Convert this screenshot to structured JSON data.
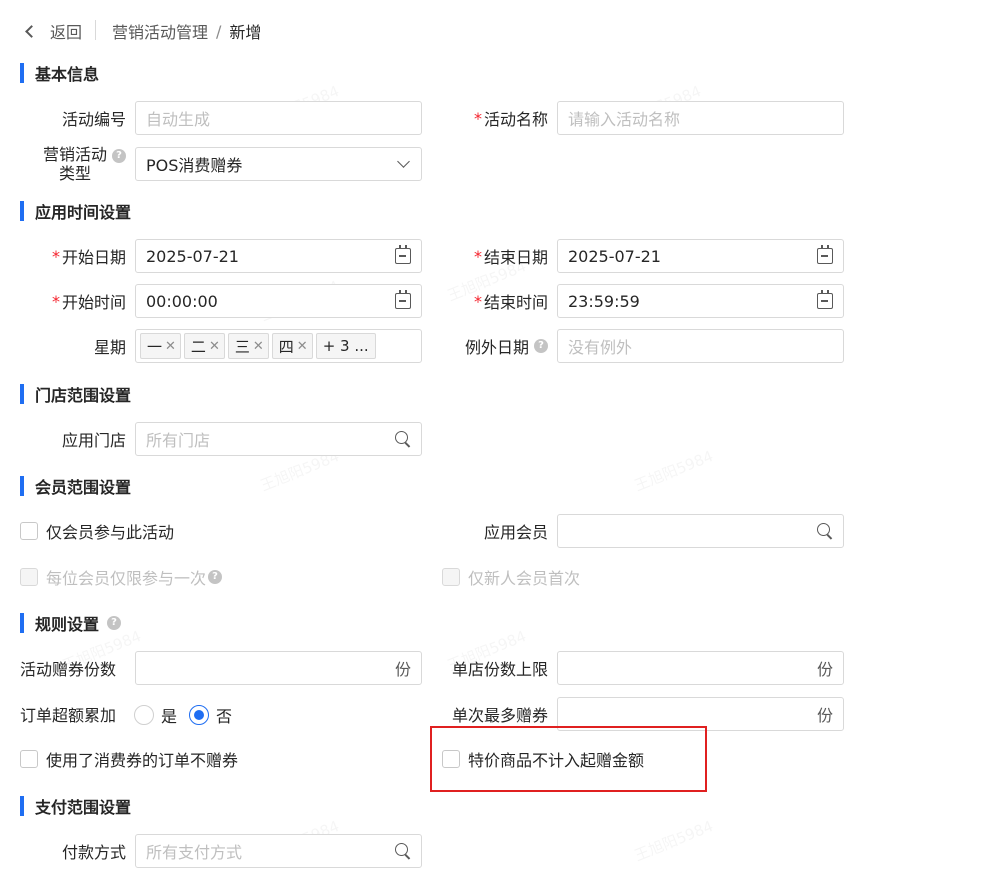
{
  "header": {
    "back_label": "返回",
    "crumb_parent": "营销活动管理",
    "crumb_sep": "/",
    "crumb_current": "新增"
  },
  "watermark": "王旭阳5984",
  "sections": {
    "basic": "基本信息",
    "time": "应用时间设置",
    "store": "门店范围设置",
    "member": "会员范围设置",
    "rules": "规则设置",
    "payment": "支付范围设置"
  },
  "basic": {
    "code_label": "活动编号",
    "code_placeholder": "自动生成",
    "name_label": "活动名称",
    "name_placeholder": "请输入活动名称",
    "type_label_1": "营销活动",
    "type_label_2": "类型",
    "type_value": "POS消费赠券"
  },
  "time": {
    "start_date_label": "开始日期",
    "start_date": "2025-07-21",
    "end_date_label": "结束日期",
    "end_date": "2025-07-21",
    "start_time_label": "开始时间",
    "start_time": "00:00:00",
    "end_time_label": "结束时间",
    "end_time": "23:59:59",
    "weekday_label": "星期",
    "weekdays": [
      "一",
      "二",
      "三",
      "四"
    ],
    "weekday_more": "+ 3 ...",
    "exception_label": "例外日期",
    "exception_placeholder": "没有例外"
  },
  "store": {
    "label": "应用门店",
    "placeholder": "所有门店"
  },
  "member": {
    "only_member_label": "仅会员参与此活动",
    "apply_member_label": "应用会员",
    "once_label": "每位会员仅限参与一次",
    "new_member_label": "仅新人会员首次"
  },
  "rules": {
    "coupon_count_label": "活动赠券份数",
    "unit": "份",
    "store_limit_label": "单店份数上限",
    "accumulate_label": "订单超额累加",
    "yes": "是",
    "no": "否",
    "selected": "否",
    "max_per_label": "单次最多赠券",
    "used_coupon_label": "使用了消费券的订单不赠券",
    "special_label": "特价商品不计入起赠金额"
  },
  "payment": {
    "label": "付款方式",
    "placeholder": "所有支付方式"
  },
  "colors": {
    "accent": "#1f6ef2",
    "required": "#f5222d",
    "highlight": "#e02020"
  }
}
